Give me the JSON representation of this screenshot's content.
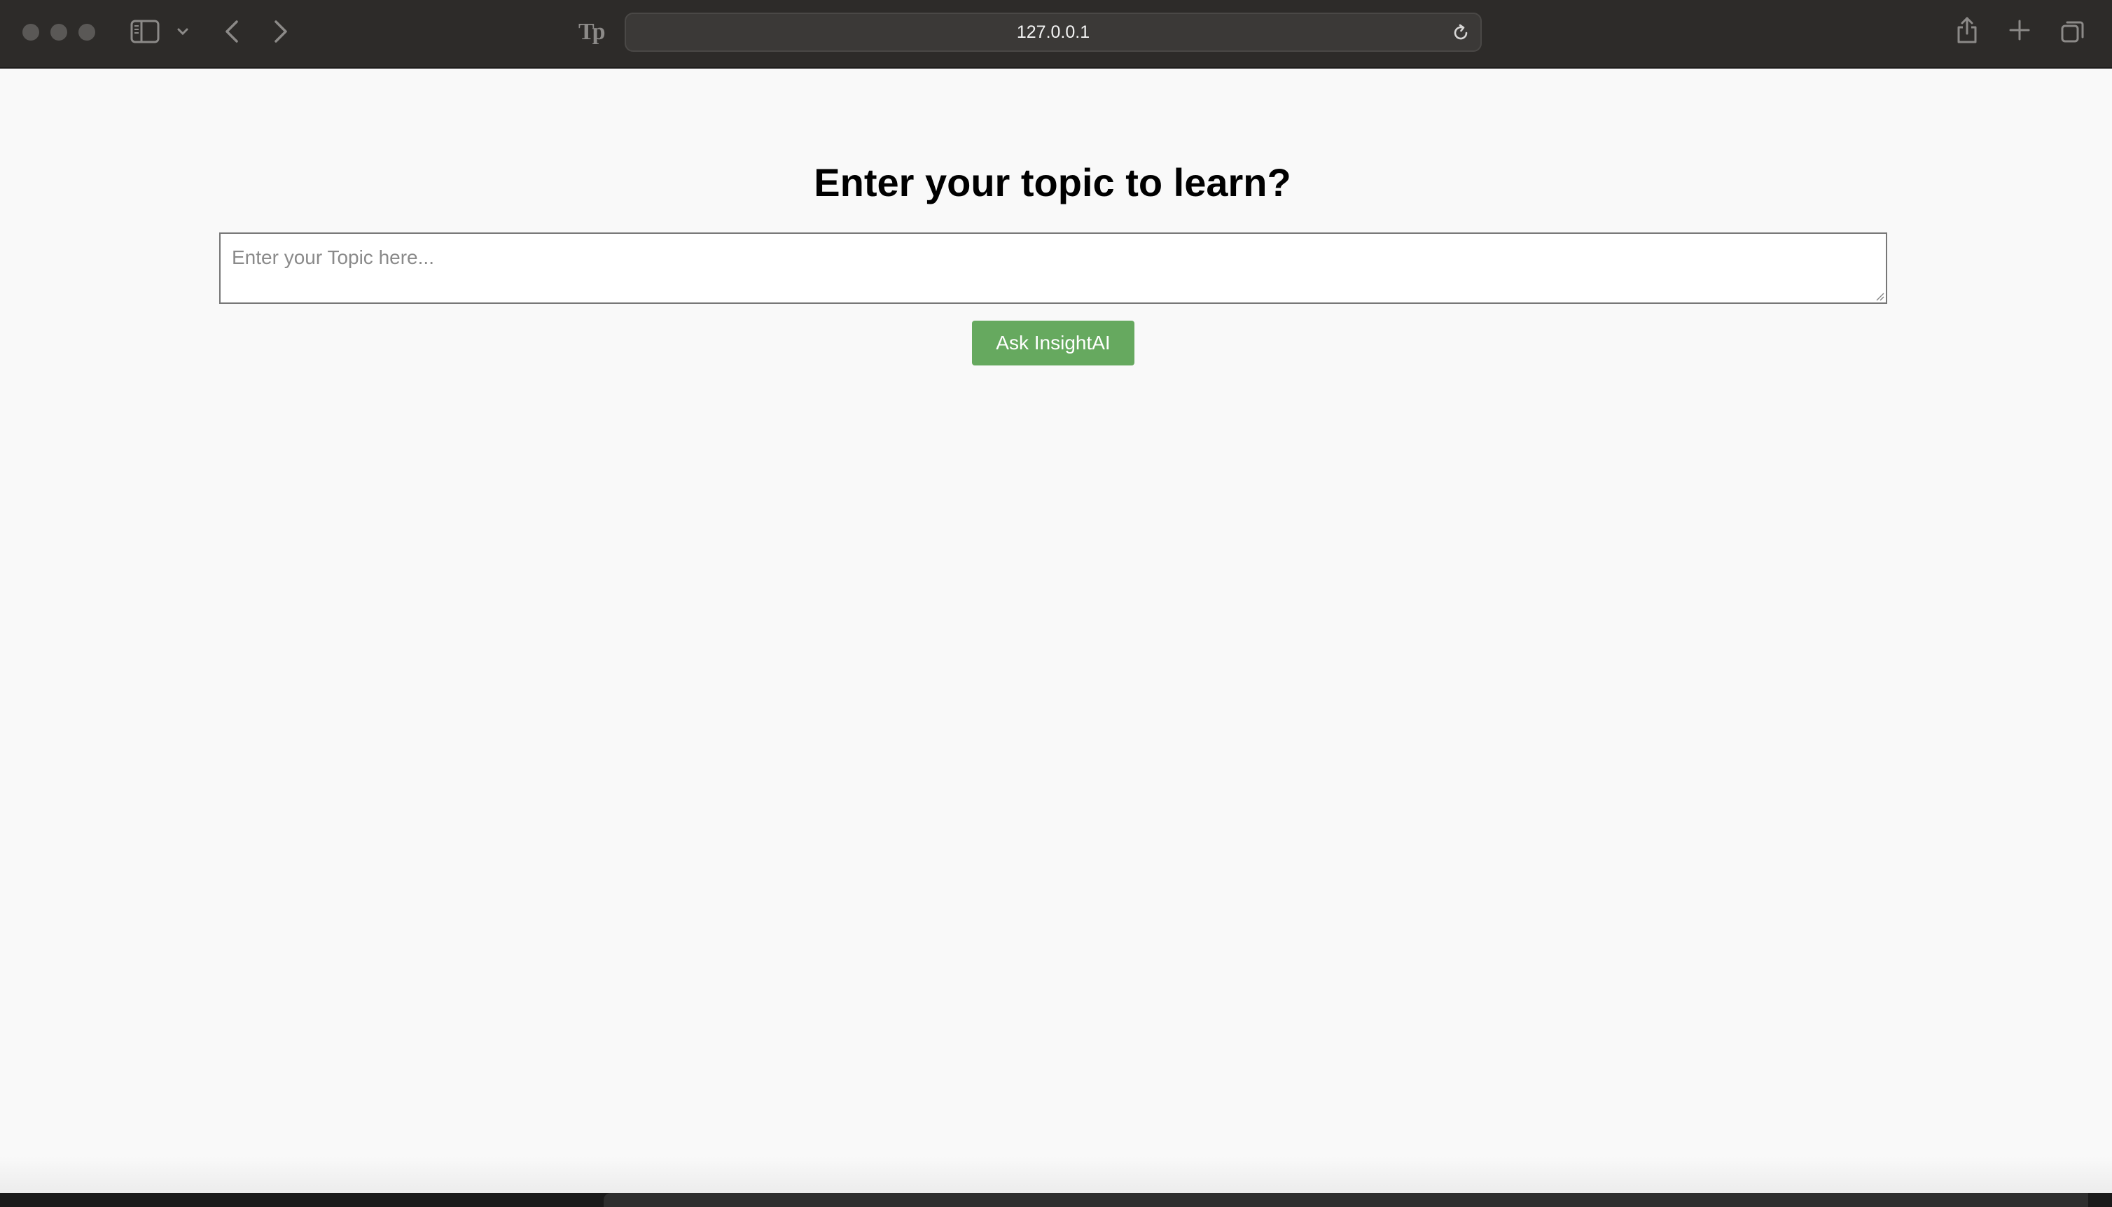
{
  "browser": {
    "url": "127.0.0.1",
    "icons": [
      "sidebar-icon",
      "chevron-down-icon",
      "back-icon",
      "forward-icon",
      "reader-icon",
      "reload-icon",
      "share-icon",
      "plus-icon",
      "tabs-overview-icon"
    ]
  },
  "page": {
    "title": "Enter your topic to learn?",
    "topic_input": {
      "placeholder": "Enter your Topic here...",
      "value": ""
    },
    "ask_button_label": "Ask InsightAI"
  },
  "colors": {
    "toolbar_bg": "#2d2b29",
    "page_bg": "#f9f9f9",
    "button_bg": "#66a95f",
    "button_text": "#ffffff"
  }
}
